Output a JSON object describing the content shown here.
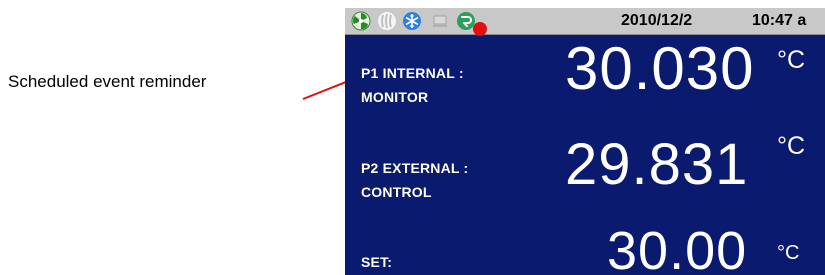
{
  "callout": {
    "text": "Scheduled event reminder",
    "leader_color": "#e01010"
  },
  "statusbar": {
    "icons": [
      {
        "name": "fan-icon",
        "color": "#2a8a2a"
      },
      {
        "name": "heater-icon",
        "color": "#e8e8e8"
      },
      {
        "name": "snowflake-icon",
        "color": "#1a6fd0"
      },
      {
        "name": "computer-icon",
        "color": "#a0a0a0"
      },
      {
        "name": "scheduled-event-icon",
        "color": "#2aa05a"
      }
    ],
    "date": "2010/12/2",
    "time": "10:47 a"
  },
  "readings": [
    {
      "label_line1": "P1 INTERNAL :",
      "label_line2": "MONITOR",
      "value": "30.030",
      "unit": "°C"
    },
    {
      "label_line1": "P2 EXTERNAL :",
      "label_line2": "CONTROL",
      "value": "29.831",
      "unit": "°C"
    },
    {
      "label_line1": "SET:",
      "label_line2": "",
      "value": "30.00",
      "unit": "°C"
    }
  ],
  "colors": {
    "screen_bg": "#0a1a6e",
    "statusbar_bg": "#c8c8c8",
    "text": "#ffffff"
  }
}
